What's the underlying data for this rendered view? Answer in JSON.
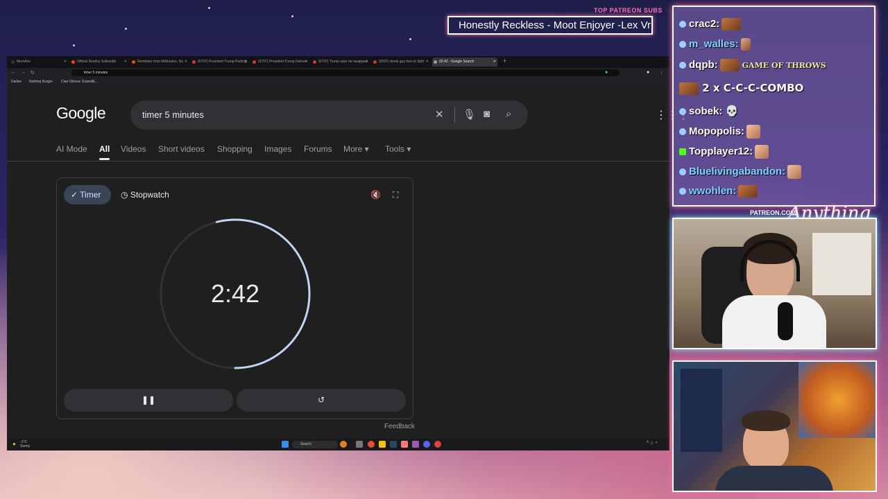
{
  "overlay": {
    "top_patreon_label": "TOP PATREON SUBS",
    "ticker_text": "Honestly Reckless - Moot Enjoyer -Lex Vr",
    "patreon_link": "PATREON.COM/",
    "signature": "Anything Else"
  },
  "browser": {
    "tabs": [
      {
        "label": "MoreAnx"
      },
      {
        "label": "Official Destiny Subreddit"
      },
      {
        "label": "Reminder from MrMouton, No"
      },
      {
        "label": "(6797) President Trump Particip"
      },
      {
        "label": "(6797) President Trump Deliver"
      },
      {
        "label": "(6797) Trump says he swapped"
      },
      {
        "label": "(6597) drunk guy tries to fight"
      },
      {
        "label": "02:42 - Google Search"
      }
    ],
    "active_tab_index": 7,
    "address": "timer 5 minutes",
    "bookmarks": [
      "Dailies",
      "Nothing Burger",
      "Clair Obscur: Expediti..."
    ]
  },
  "google": {
    "logo": "Google",
    "query": "timer 5 minutes",
    "nav": [
      {
        "label": "AI Mode"
      },
      {
        "label": "All"
      },
      {
        "label": "Videos"
      },
      {
        "label": "Short videos"
      },
      {
        "label": "Shopping"
      },
      {
        "label": "Images"
      },
      {
        "label": "Forums"
      },
      {
        "label": "More ▾"
      },
      {
        "label": "Tools ▾"
      }
    ],
    "active_nav_index": 1
  },
  "timer": {
    "tab_timer": "Timer",
    "tab_stopwatch": "Stopwatch",
    "time": "2:42",
    "remaining_fraction": 0.54,
    "feedback": "Feedback"
  },
  "taskbar": {
    "weather_temp": "-1°C",
    "weather_cond": "Sunny",
    "search": "Search"
  },
  "chat": {
    "messages": [
      {
        "user": "crac2:",
        "badge": "blue"
      },
      {
        "user": "m_walles:",
        "badge": "blue"
      },
      {
        "user": "dqpb:",
        "badge": "blue",
        "emote_text": "GAME OF THROWS"
      },
      {
        "user": "",
        "badge": "none",
        "combo": "2 x C-C-C-COMBO"
      },
      {
        "user": "sobek:",
        "badge": "blue"
      },
      {
        "user": "Mopopolis:",
        "badge": "blue"
      },
      {
        "user": "Topplayer12:",
        "badge": "green"
      },
      {
        "user": "Bluelivingabandon:",
        "badge": "blue"
      },
      {
        "user": "wwohlen:",
        "badge": "blue"
      }
    ]
  }
}
